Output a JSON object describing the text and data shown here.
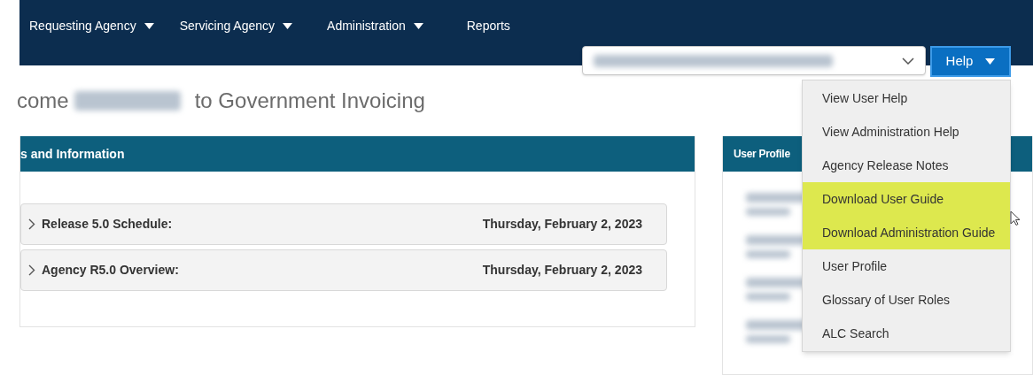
{
  "nav": {
    "items": [
      {
        "label": "Requesting Agency",
        "dropdown": true
      },
      {
        "label": "Servicing Agency",
        "dropdown": true
      },
      {
        "label": "Administration",
        "dropdown": true
      },
      {
        "label": "Reports",
        "dropdown": false
      }
    ]
  },
  "help_button": {
    "label": "Help",
    "expanded": true
  },
  "help_menu": {
    "items": [
      {
        "label": "View User Help",
        "highlighted": false
      },
      {
        "label": "View Administration Help",
        "highlighted": false
      },
      {
        "label": "Agency Release Notes",
        "highlighted": false
      },
      {
        "label": "Download User Guide",
        "highlighted": true
      },
      {
        "label": "Download Administration Guide",
        "highlighted": true
      },
      {
        "label": "User Profile",
        "highlighted": false
      },
      {
        "label": "Glossary of User Roles",
        "highlighted": false
      },
      {
        "label": "ALC Search",
        "highlighted": false
      }
    ]
  },
  "welcome": {
    "before": "come",
    "after": "to Government Invoicing"
  },
  "news_panel": {
    "title": "s and Information",
    "rows": [
      {
        "title": "Release 5.0 Schedule:",
        "date": "Thursday, February 2, 2023",
        "expanded": false
      },
      {
        "title": "Agency R5.0 Overview:",
        "date": "Thursday, February 2, 2023",
        "expanded": false
      }
    ]
  },
  "profile_panel": {
    "title": "User Profile"
  }
}
